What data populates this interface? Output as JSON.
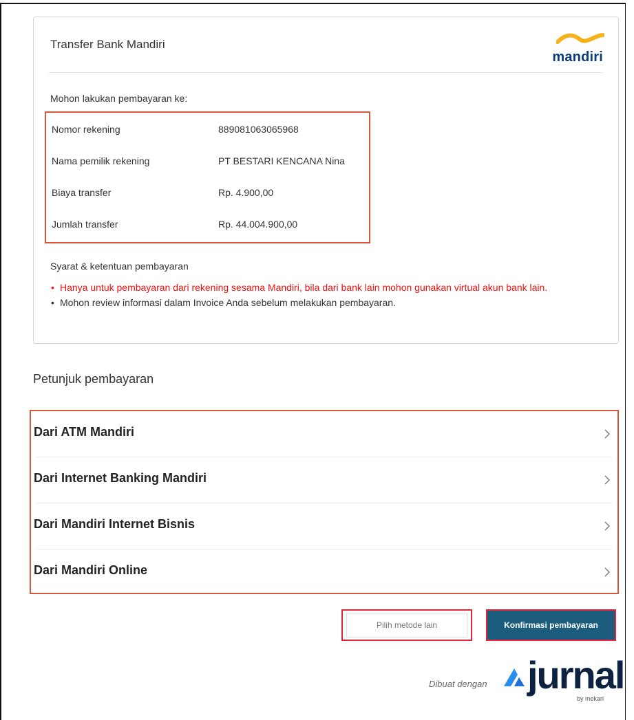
{
  "card": {
    "title": "Transfer Bank Mandiri",
    "bank_logo_text": "mandiri",
    "instruction": "Mohon lakukan pembayaran ke:",
    "details": [
      {
        "label": "Nomor rekening",
        "value": "889081063065968"
      },
      {
        "label": "Nama pemilik rekening",
        "value": "PT BESTARI KENCANA Nina"
      },
      {
        "label": "Biaya transfer",
        "value": "Rp. 4.900,00"
      },
      {
        "label": "Jumlah transfer",
        "value": "Rp. 44.004.900,00"
      }
    ],
    "terms_heading": "Syarat & ketentuan pembayaran",
    "terms": [
      "Hanya untuk pembayaran dari rekening sesama Mandiri, bila dari bank lain mohon gunakan virtual akun bank lain.",
      "Mohon review informasi dalam Invoice Anda sebelum melakukan pembayaran."
    ]
  },
  "instructions_section": {
    "title": "Petunjuk pembayaran",
    "items": [
      {
        "label": "Dari ATM Mandiri"
      },
      {
        "label": "Dari Internet Banking Mandiri"
      },
      {
        "label": "Dari Mandiri Internet Bisnis"
      },
      {
        "label": "Dari Mandiri Online"
      }
    ],
    "chevron_icon": "chevron-right-icon"
  },
  "actions": {
    "secondary_label": "Pilih metode lain",
    "primary_label": "Konfirmasi pembayaran"
  },
  "footer": {
    "made_with": "Dibuat dengan",
    "brand": "jurnal",
    "brand_sub": "by mekari"
  },
  "colors": {
    "highlight_border": "#d9573a",
    "button_border": "#e0263a",
    "primary_button": "#1c5d7e",
    "warning_text": "#ee1111",
    "mandiri_blue": "#0b3d78",
    "mandiri_gold": "#f5b21b"
  }
}
